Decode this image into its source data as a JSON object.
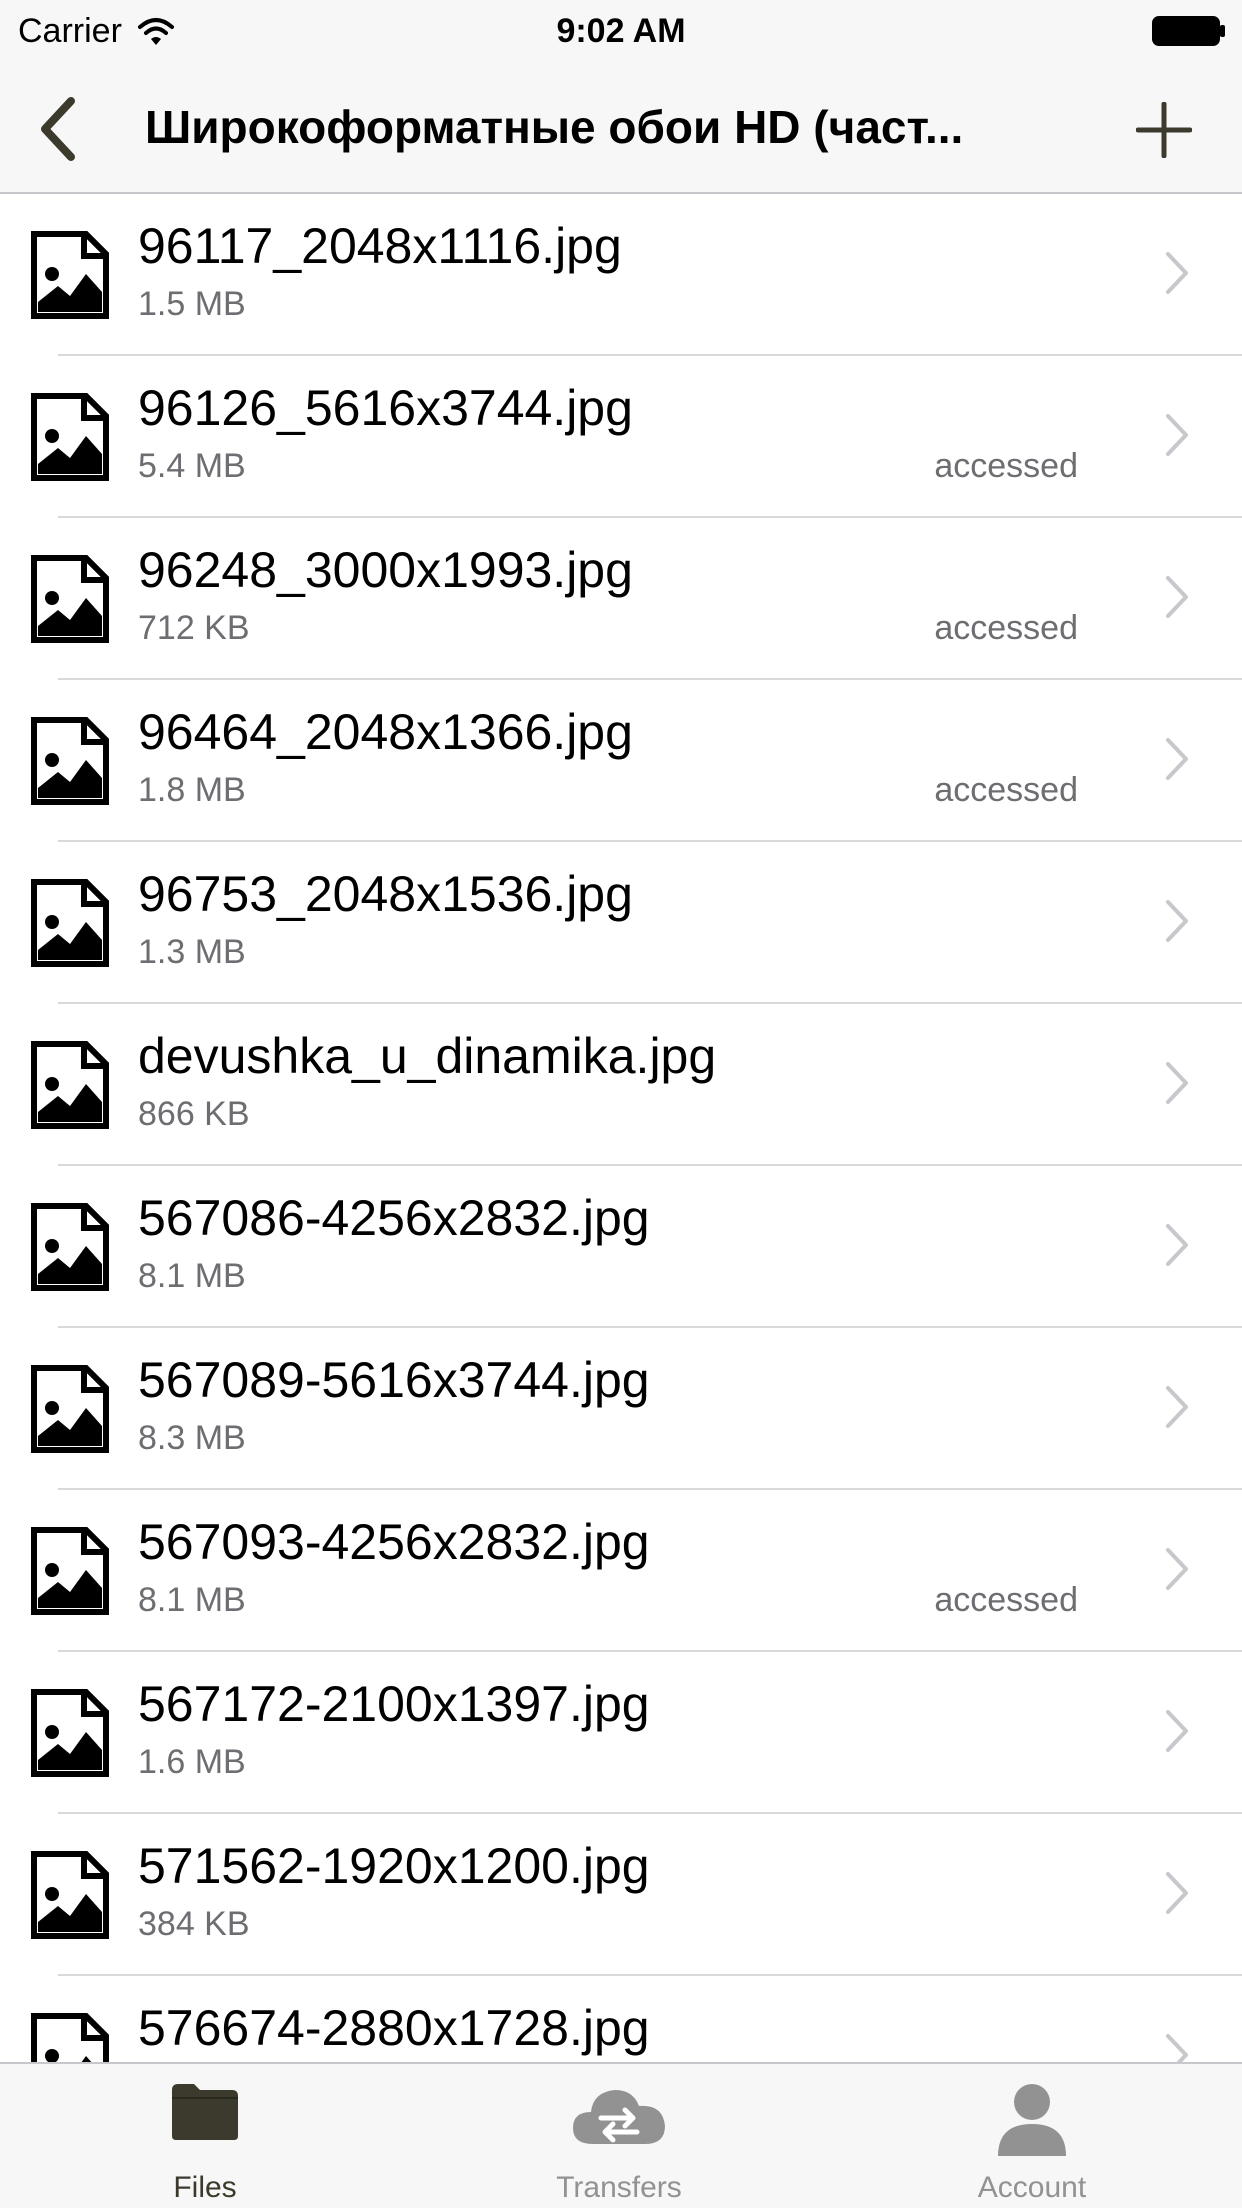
{
  "status_bar": {
    "carrier": "Carrier",
    "time": "9:02 AM"
  },
  "nav": {
    "title": "Широкоформатные обои HD (част...",
    "back_icon": "chevron-left-icon",
    "add_icon": "plus-icon"
  },
  "colors": {
    "accent": "#3b3a2c",
    "secondary_text": "#6d6d72",
    "chevron": "#c7c7cc",
    "inactive_tab": "#929292"
  },
  "files": [
    {
      "name": "96117_2048x1116.jpg",
      "size": "1.5 MB",
      "status": ""
    },
    {
      "name": "96126_5616x3744.jpg",
      "size": "5.4 MB",
      "status": "accessed"
    },
    {
      "name": "96248_3000x1993.jpg",
      "size": "712 KB",
      "status": "accessed"
    },
    {
      "name": "96464_2048x1366.jpg",
      "size": "1.8 MB",
      "status": "accessed"
    },
    {
      "name": "96753_2048x1536.jpg",
      "size": "1.3 MB",
      "status": ""
    },
    {
      "name": "devushka_u_dinamika.jpg",
      "size": "866 KB",
      "status": ""
    },
    {
      "name": "567086-4256x2832.jpg",
      "size": "8.1 MB",
      "status": ""
    },
    {
      "name": "567089-5616x3744.jpg",
      "size": "8.3 MB",
      "status": ""
    },
    {
      "name": "567093-4256x2832.jpg",
      "size": "8.1 MB",
      "status": "accessed"
    },
    {
      "name": "567172-2100x1397.jpg",
      "size": "1.6 MB",
      "status": ""
    },
    {
      "name": "571562-1920x1200.jpg",
      "size": "384 KB",
      "status": ""
    },
    {
      "name": "576674-2880x1728.jpg",
      "size": "",
      "status": ""
    }
  ],
  "tabs": [
    {
      "label": "Files",
      "icon": "folder-icon",
      "active": true
    },
    {
      "label": "Transfers",
      "icon": "cloud-transfer-icon",
      "active": false
    },
    {
      "label": "Account",
      "icon": "person-icon",
      "active": false
    }
  ]
}
